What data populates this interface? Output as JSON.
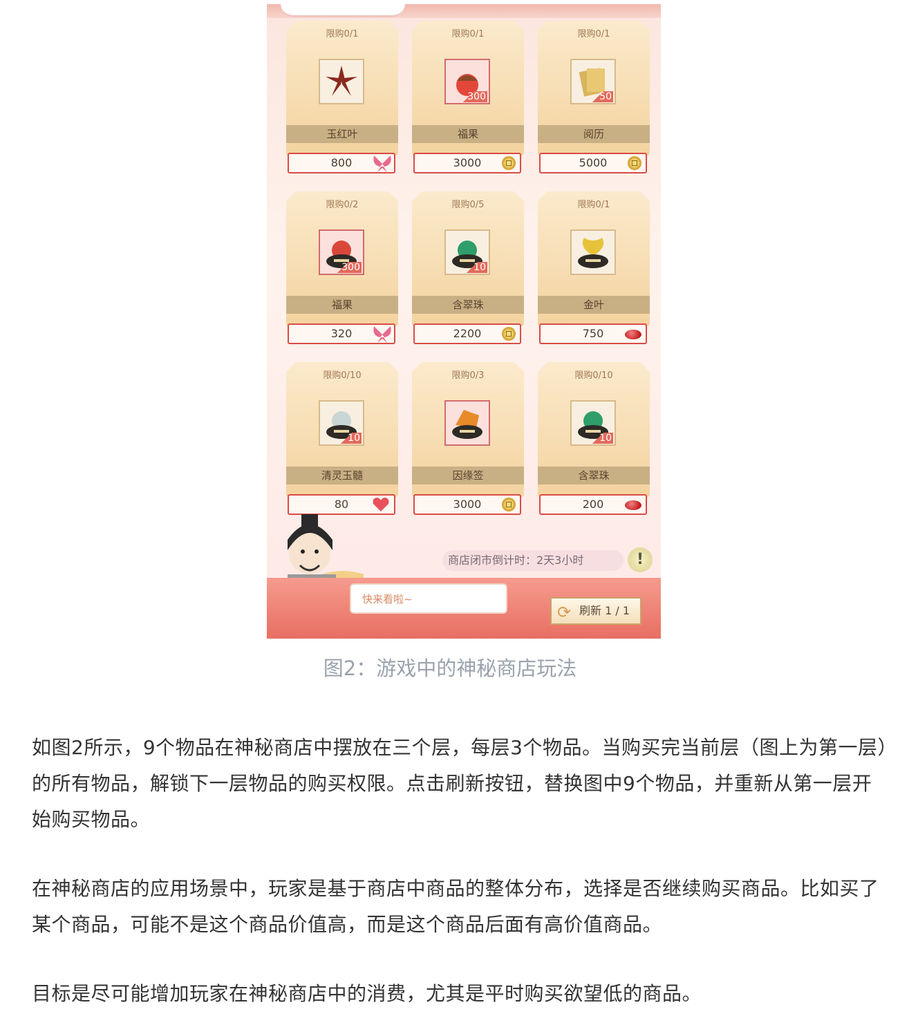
{
  "shop": {
    "items": [
      {
        "limit": "限购0/1",
        "name": "玉红叶",
        "price": "800",
        "qty": "",
        "currency": "butterfly-icon",
        "icon": "star-anise-icon",
        "frame": "plain"
      },
      {
        "limit": "限购0/1",
        "name": "福果",
        "price": "3000",
        "qty": "300",
        "currency": "coin-icon",
        "icon": "red-fruit-icon",
        "frame": "red"
      },
      {
        "limit": "限购0/1",
        "name": "阅历",
        "price": "5000",
        "qty": "50",
        "currency": "coin-icon",
        "icon": "book-icon",
        "frame": "plain"
      },
      {
        "limit": "限购0/2",
        "name": "福果",
        "price": "320",
        "qty": "300",
        "currency": "butterfly-icon",
        "icon": "red-fruit-bowl-icon",
        "frame": "red"
      },
      {
        "limit": "限购0/5",
        "name": "含翠珠",
        "price": "2200",
        "qty": "10",
        "currency": "coin-icon",
        "icon": "green-bead-icon",
        "frame": "plain"
      },
      {
        "limit": "限购0/1",
        "name": "金叶",
        "price": "750",
        "qty": "",
        "currency": "bean-icon",
        "icon": "ginkgo-leaf-icon",
        "frame": "plain"
      },
      {
        "limit": "限购0/10",
        "name": "清灵玉髓",
        "price": "80",
        "qty": "10",
        "currency": "heart-icon",
        "icon": "white-jade-icon",
        "frame": "plain"
      },
      {
        "limit": "限购0/3",
        "name": "因缘签",
        "price": "3000",
        "qty": "",
        "currency": "coin-icon",
        "icon": "orange-gem-icon",
        "frame": "red"
      },
      {
        "limit": "限购0/10",
        "name": "含翠珠",
        "price": "200",
        "qty": "10",
        "currency": "bean-icon",
        "icon": "green-bead-icon",
        "frame": "plain"
      }
    ],
    "countdown": "商店闭市倒计时：2天3小时",
    "info_label": "!",
    "speech": "快来看啦~",
    "refresh_label": "刷新 1 / 1"
  },
  "caption": "图2：游戏中的神秘商店玩法",
  "paragraphs": [
    "如图2所示，9个物品在神秘商店中摆放在三个层，每层3个物品。当购买完当前层（图上为第一层）的所有物品，解锁下一层物品的购买权限。点击刷新按钮，替换图中9个物品，并重新从第一层开始购买物品。",
    "在神秘商店的应用场景中，玩家是基于商店中商品的整体分布，选择是否继续购买商品。比如买了某个商品，可能不是这个商品价值高，而是这个商品后面有高价值商品。",
    "目标是尽可能增加玩家在神秘商店中的消费，尤其是平时购买欲望低的商品。"
  ]
}
